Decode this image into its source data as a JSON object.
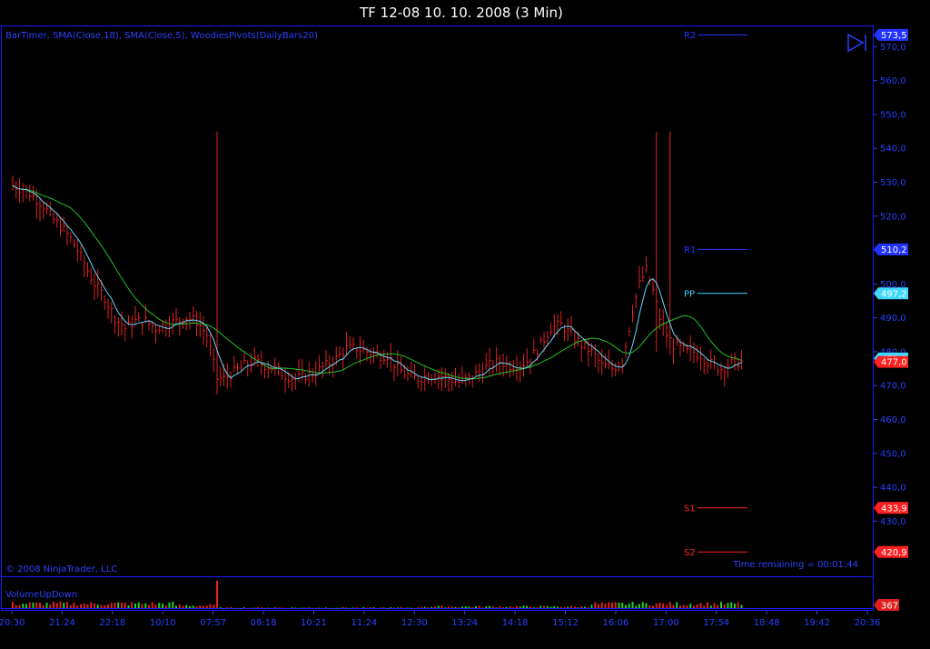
{
  "colors": {
    "background": "#000000",
    "frame": "#1a1aff",
    "axis_text": "#2840ff",
    "bar_up": "#e02020",
    "bar_down": "#e02020",
    "sma_slow": "#22c022",
    "sma_fast": "#60d8ff",
    "vol_up": "#22d022",
    "vol_down": "#e02020",
    "resistance": "#2233ff",
    "pivot": "#40d8ff",
    "support": "#ff2020"
  },
  "icons": {
    "scroll_end": "play-to-end-icon"
  },
  "chart_data": [
    {
      "type": "ohlc",
      "title": "TF 12-08  10. 10. 2008 (3 Min)",
      "indicators_label": "BarTimer, SMA(Close,18), SMA(Close,5), WoodiesPivots(DailyBars20)",
      "copyright": "© 2008 NinjaTrader, LLC",
      "time_remaining": "Time remaining = 00:01:44",
      "ylim": [
        414,
        576
      ],
      "y_ticks": [
        "570,0",
        "560,0",
        "550,0",
        "540,0",
        "530,0",
        "520,0",
        "510,0",
        "500,0",
        "490,0",
        "480,0",
        "470,0",
        "460,0",
        "450,0",
        "440,0",
        "430,0"
      ],
      "y_tick_values": [
        570,
        560,
        550,
        540,
        530,
        520,
        510,
        500,
        490,
        480,
        470,
        460,
        450,
        440,
        430
      ],
      "x_ticks": [
        "20:30",
        "21:24",
        "22:18",
        "10/10",
        "07:57",
        "09:18",
        "10:21",
        "11:24",
        "12:30",
        "13:24",
        "14:18",
        "15:12",
        "16:06",
        "17:00",
        "17:54",
        "18:48",
        "19:42",
        "20:36"
      ],
      "price_badges": [
        {
          "label": "573,5",
          "value": 573.5,
          "kind": "resistance"
        },
        {
          "label": "510,2",
          "value": 510.2,
          "kind": "resistance"
        },
        {
          "label": "497,2",
          "value": 497.2,
          "kind": "pivot"
        },
        {
          "label": "478,0",
          "value": 478.0,
          "kind": "pivot"
        },
        {
          "label": "477,0",
          "value": 477.0,
          "kind": "support"
        },
        {
          "label": "433,9",
          "value": 433.9,
          "kind": "support"
        },
        {
          "label": "420,9",
          "value": 420.9,
          "kind": "support"
        }
      ],
      "pivots": [
        {
          "name": "R2",
          "value": 573.5
        },
        {
          "name": "R1",
          "value": 510.2
        },
        {
          "name": "PP",
          "value": 497.2
        },
        {
          "name": "S1",
          "value": 433.9
        },
        {
          "name": "S2",
          "value": 420.9
        }
      ],
      "price_path": [
        [
          0,
          529
        ],
        [
          3,
          528
        ],
        [
          6,
          526
        ],
        [
          9,
          523
        ],
        [
          12,
          519
        ],
        [
          15,
          516
        ],
        [
          18,
          512
        ],
        [
          21,
          506
        ],
        [
          24,
          500
        ],
        [
          27,
          496
        ],
        [
          30,
          490
        ],
        [
          33,
          487
        ],
        [
          36,
          489
        ],
        [
          39,
          489
        ],
        [
          42,
          487
        ],
        [
          45,
          488
        ],
        [
          48,
          489
        ],
        [
          51,
          490
        ],
        [
          54,
          489
        ],
        [
          57,
          485
        ],
        [
          60,
          472
        ],
        [
          62,
          472
        ],
        [
          65,
          474
        ],
        [
          68,
          476
        ],
        [
          71,
          477
        ],
        [
          74,
          476
        ],
        [
          77,
          475
        ],
        [
          80,
          473
        ],
        [
          83,
          472
        ],
        [
          86,
          473
        ],
        [
          89,
          474
        ],
        [
          92,
          476
        ],
        [
          95,
          478
        ],
        [
          98,
          481
        ],
        [
          101,
          481
        ],
        [
          104,
          480
        ],
        [
          107,
          479
        ],
        [
          110,
          479
        ],
        [
          113,
          475
        ],
        [
          116,
          473
        ],
        [
          119,
          472
        ],
        [
          122,
          473
        ],
        [
          125,
          473
        ],
        [
          128,
          472
        ],
        [
          131,
          471
        ],
        [
          134,
          472
        ],
        [
          137,
          474
        ],
        [
          140,
          476
        ],
        [
          143,
          477
        ],
        [
          146,
          476
        ],
        [
          149,
          476
        ],
        [
          152,
          478
        ],
        [
          155,
          482
        ],
        [
          158,
          487
        ],
        [
          161,
          488
        ],
        [
          164,
          485
        ],
        [
          167,
          482
        ],
        [
          170,
          480
        ],
        [
          173,
          476
        ],
        [
          176,
          475
        ],
        [
          179,
          477
        ],
        [
          182,
          492
        ],
        [
          184,
          500
        ],
        [
          186,
          504
        ],
        [
          188,
          498
        ],
        [
          190,
          490
        ],
        [
          192,
          485
        ],
        [
          194,
          482
        ],
        [
          196,
          481
        ],
        [
          198,
          480
        ],
        [
          200,
          480
        ],
        [
          202,
          479
        ],
        [
          204,
          477
        ],
        [
          206,
          476
        ],
        [
          208,
          475
        ],
        [
          210,
          476
        ],
        [
          212,
          477
        ],
        [
          214,
          477
        ]
      ],
      "spikes": [
        {
          "index": 60,
          "high": 545,
          "low": 487
        },
        {
          "index": 189,
          "high": 545,
          "low": 480
        },
        {
          "index": 193,
          "high": 545,
          "low": 479
        }
      ],
      "volume_label": "VolumeUpDown",
      "volume_badge": "367",
      "volume_max": 367,
      "volume_spike_index": 60
    }
  ]
}
